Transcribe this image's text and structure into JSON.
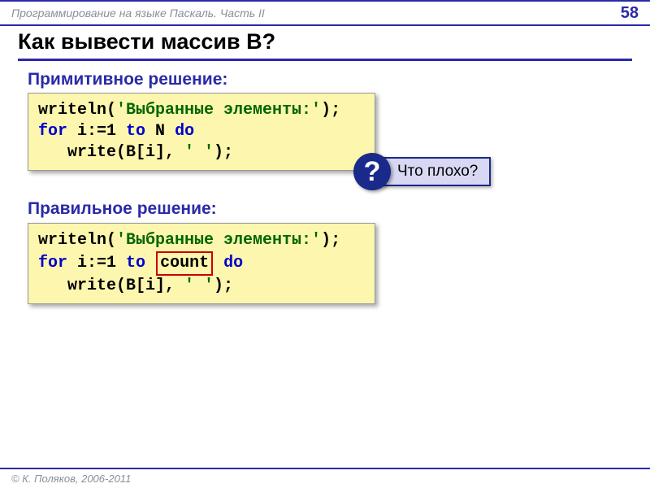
{
  "header": {
    "title": "Программирование на языке Паскаль. Часть II",
    "page": "58"
  },
  "title": "Как вывести массив B?",
  "section1": {
    "heading": "Примитивное решение:",
    "code": {
      "line1_a": "writeln(",
      "line1_str": "'Выбранные элементы:'",
      "line1_b": ");",
      "line2_a": "for",
      "line2_b": " i:=1 ",
      "line2_c": "to",
      "line2_d": " N ",
      "line2_e": "do",
      "line3_a": "   write(B[i], ",
      "line3_str": "' '",
      "line3_b": ");"
    }
  },
  "callout": {
    "icon": "?",
    "text": "Что плохо?"
  },
  "section2": {
    "heading": "Правильное решение:",
    "code": {
      "line1_a": "writeln(",
      "line1_str": "'Выбранные элементы:'",
      "line1_b": ");",
      "line2_a": "for",
      "line2_b": " i:=1 ",
      "line2_c": "to",
      "line2_count": "count",
      "line2_d": " ",
      "line2_e": "do",
      "line3_a": "   write(B[i], ",
      "line3_str": "' '",
      "line3_b": ");"
    }
  },
  "footer": "© К. Поляков, 2006-2011"
}
